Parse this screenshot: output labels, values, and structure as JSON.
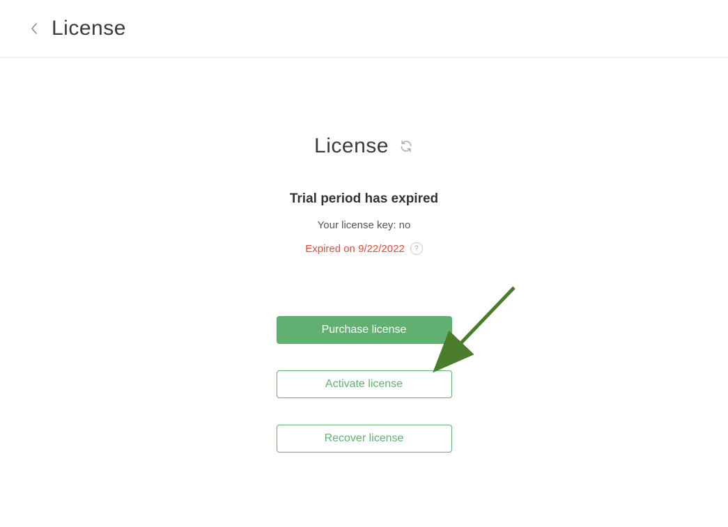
{
  "header": {
    "title": "License"
  },
  "section": {
    "title": "License"
  },
  "status": {
    "heading": "Trial period has expired",
    "key_line": "Your license key: no",
    "expired_line": "Expired on 9/22/2022"
  },
  "buttons": {
    "purchase": "Purchase license",
    "activate": "Activate license",
    "recover": "Recover license"
  },
  "help_icon_glyph": "?"
}
